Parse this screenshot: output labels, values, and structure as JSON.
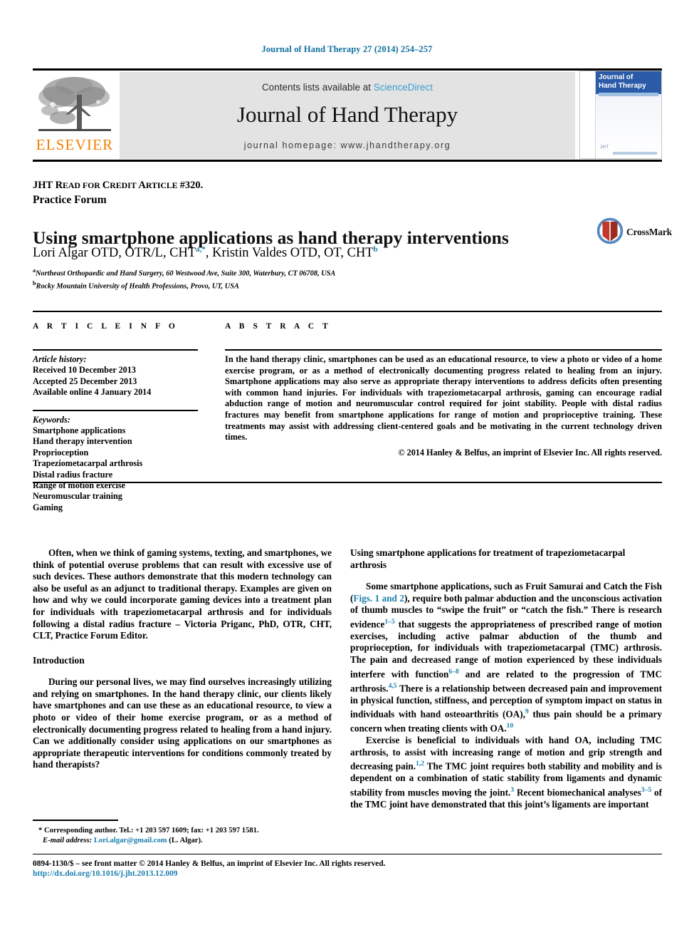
{
  "running_head": "Journal of Hand Therapy 27 (2014) 254–257",
  "masthead": {
    "contents_prefix": "Contents lists available at ",
    "sciencedirect": "ScienceDirect",
    "journal_title": "Journal of Hand Therapy",
    "homepage": "journal homepage: www.jhandtherapy.org",
    "publisher_name": "ELSEVIER",
    "cover_title_line1": "Journal of",
    "cover_title_line2": "Hand Therapy",
    "cover_footer_mark": "JHT"
  },
  "article": {
    "credit_line_main": "JHT R",
    "credit_sc1": "EAD FOR ",
    "credit_mid": "C",
    "credit_sc2": "REDIT ",
    "credit_mid2": "A",
    "credit_sc3": "RTICLE ",
    "credit_number": "#320.",
    "section_label": "Practice Forum",
    "title": "Using smartphone applications as hand therapy interventions",
    "authors_part1": "Lori Algar OTD, OTR/L, CHT",
    "authors_sup1": "a,*",
    "authors_part2": ", Kristin Valdes OTD, OT, CHT",
    "authors_sup2": "b",
    "affiliation_a_marker": "a",
    "affiliation_a": "Northeast Orthopaedic and Hand Surgery, 60 Westwood Ave, Suite 300, Waterbury, CT 06708, USA",
    "affiliation_b_marker": "b",
    "affiliation_b": "Rocky Mountain University of Health Professions, Provo, UT, USA",
    "crossmark_label": "CrossMark"
  },
  "article_info": {
    "heading": "A R T I C L E  I N F O",
    "history_label": "Article history:",
    "history": [
      "Received 10 December 2013",
      "Accepted 25 December 2013",
      "Available online 4 January 2014"
    ],
    "keywords_label": "Keywords:",
    "keywords": [
      "Smartphone applications",
      "Hand therapy intervention",
      "Proprioception",
      "Trapeziometacarpal arthrosis",
      "Distal radius fracture",
      "Range of motion exercise",
      "Neuromuscular training",
      "Gaming"
    ]
  },
  "abstract": {
    "heading": "A B S T R A C T",
    "text": "In the hand therapy clinic, smartphones can be used as an educational resource, to view a photo or video of a home exercise program, or as a method of electronically documenting progress related to healing from an injury. Smartphone applications may also serve as appropriate therapy interventions to address deficits often presenting with common hand injuries. For individuals with trapeziometacarpal arthrosis, gaming can encourage radial abduction range of motion and neuromuscular control required for joint stability. People with distal radius fractures may benefit from smartphone applications for range of motion and proprioceptive training. These treatments may assist with addressing client-centered goals and be motivating in the current technology driven times.",
    "copyright": "© 2014 Hanley & Belfus, an imprint of Elsevier Inc. All rights reserved."
  },
  "body": {
    "editor_note": "Often, when we think of gaming systems, texting, and smartphones, we think of potential overuse problems that can result with excessive use of such devices. These authors demonstrate that this modern technology can also be useful as an adjunct to traditional therapy. Examples are given on how and why we could incorporate gaming devices into a treatment plan for individuals with trapeziometacarpal arthrosis and for individuals following a distal radius fracture – Victoria Priganc, PhD, OTR, CHT, CLT, Practice Forum Editor.",
    "intro_heading": "Introduction",
    "intro_paragraph": "During our personal lives, we may find ourselves increasingly utilizing and relying on smartphones. In the hand therapy clinic, our clients likely have smartphones and can use these as an educational resource, to view a photo or video of their home exercise program, or as a method of electronically documenting progress related to healing from a hand injury. Can we additionally consider using applications on our smartphones as appropriate therapeutic interventions for conditions commonly treated by hand therapists?",
    "tmc_heading": "Using smartphone applications for treatment of trapeziometacarpal arthrosis",
    "tmc_p1_a": "Some smartphone applications, such as Fruit Samurai and Catch the Fish (",
    "tmc_p1_figlink": "Figs. 1 and 2",
    "tmc_p1_b": "), require both palmar abduction and the unconscious activation of thumb muscles to “swipe the fruit” or “catch the fish.” There is research evidence",
    "tmc_p1_cite1": "1–5",
    "tmc_p1_c": " that suggests the appropriateness of prescribed range of motion exercises, including active palmar abduction of the thumb and proprioception, for individuals with trapeziometacarpal (TMC) arthrosis. The pain and decreased range of motion experienced by these individuals interfere with function",
    "tmc_p1_cite2": "6–8",
    "tmc_p1_d": " and are related to the progression of TMC arthrosis.",
    "tmc_p1_cite3": "4,5",
    "tmc_p1_e": " There is a relationship between decreased pain and improvement in physical function, stiffness, and perception of symptom impact on status in individuals with hand osteoarthritis (OA),",
    "tmc_p1_cite4": "9",
    "tmc_p1_f": " thus pain should be a primary concern when treating clients with OA.",
    "tmc_p1_cite5": "10",
    "tmc_p2_a": "Exercise is beneficial to individuals with hand OA, including TMC arthrosis, to assist with increasing range of motion and grip strength and decreasing pain.",
    "tmc_p2_cite1": "1,2",
    "tmc_p2_b": " The TMC joint requires both stability and mobility and is dependent on a combination of static stability from ligaments and dynamic stability from muscles moving the joint.",
    "tmc_p2_cite2": "3",
    "tmc_p2_c": " Recent biomechanical analyses",
    "tmc_p2_cite3": "3–5",
    "tmc_p2_d": " of the TMC joint have demonstrated that this joint’s ligaments are important"
  },
  "footnote": {
    "marker": "*",
    "corresponding": "Corresponding author. Tel.: +1 203 597 1609; fax: +1 203 597 1581.",
    "email_label": "E-mail address:",
    "email": "Lori.algar@gmail.com",
    "email_suffix": "(L. Algar)."
  },
  "page_footer": {
    "issn_line": "0894-1130/$ – see front matter © 2014 Hanley & Belfus, an imprint of Elsevier Inc. All rights reserved.",
    "doi": "http://dx.doi.org/10.1016/j.jht.2013.12.009"
  },
  "colors": {
    "link_teal": "#1a7fae",
    "header_blue": "#0f6e9e",
    "elsevier_orange": "#f08000",
    "cover_blue": "#2b5aa8"
  }
}
